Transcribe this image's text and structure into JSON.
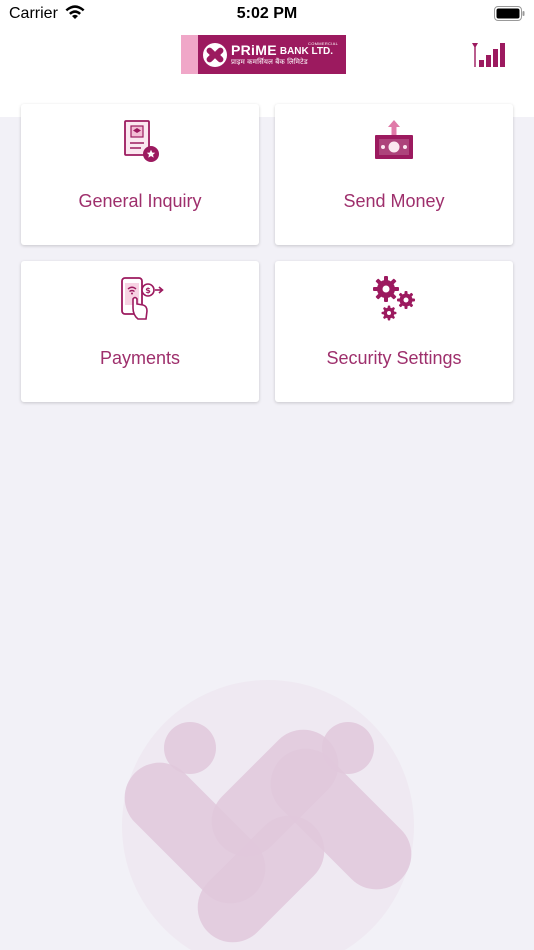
{
  "status_bar": {
    "carrier": "Carrier",
    "time": "5:02 PM",
    "wifi_icon": "wifi-icon",
    "battery_icon": "battery-full-icon"
  },
  "header": {
    "logo": {
      "name": "PRiME",
      "suffix": "BANK LTD.",
      "tagline_small": "COMMERCIAL",
      "subtitle": "प्राइम कमर्सियल बैंक लिमिटेड"
    },
    "signal_icon": "signal-strength-icon"
  },
  "menu": {
    "items": [
      {
        "label": "General Inquiry",
        "icon": "document-badge-icon"
      },
      {
        "label": "Send Money",
        "icon": "send-money-icon"
      },
      {
        "label": "Payments",
        "icon": "mobile-payment-icon"
      },
      {
        "label": "Security Settings",
        "icon": "gears-icon"
      }
    ]
  },
  "colors": {
    "brand": "#9c1a5f",
    "brand_light": "#f0a7c8",
    "label": "#9e2f6c",
    "background": "#f2f1f7"
  }
}
